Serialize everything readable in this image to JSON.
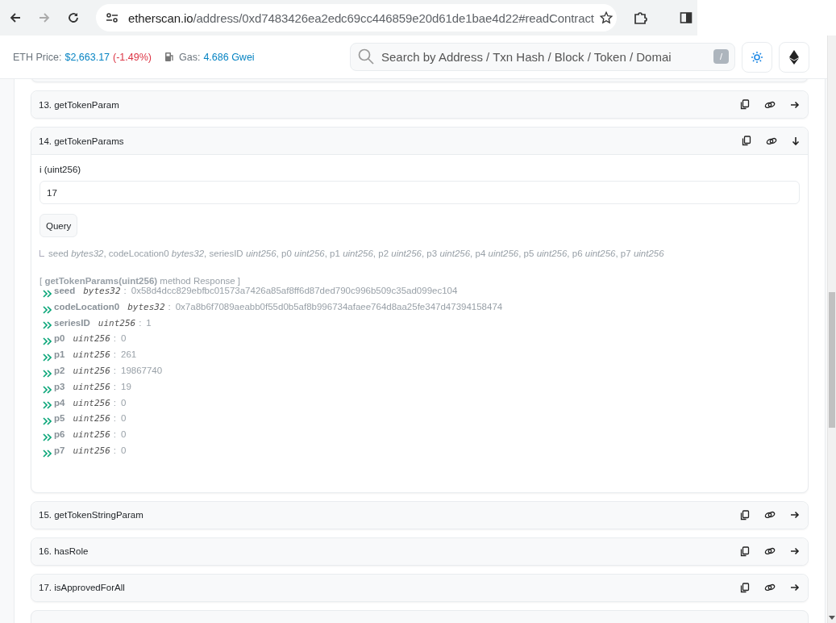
{
  "browser": {
    "url_host": "etherscan.io",
    "url_path": "/address/0xd7483426ea2edc69cc446859e20d61de1bae4d22#readContract",
    "forward_disabled": true
  },
  "header": {
    "price_label": "ETH Price:",
    "price": "$2,663.17",
    "price_change": "(-1.49%)",
    "gas_label": "Gas:",
    "gas": "4.686 Gwei",
    "search_placeholder": "Search by Address / Txn Hash / Block / Token / Domai",
    "search_key": "/"
  },
  "functions": [
    {
      "label": "13. getTokenParam",
      "expanded": false
    },
    {
      "label": "14. getTokenParams",
      "expanded": true,
      "input_label": "i (uint256)",
      "input_value": "17",
      "button": "Query",
      "signature": "seed *bytes32*, codeLocation0 *bytes32*, seriesID *uint256*, p0 *uint256*, p1 *uint256*, p2 *uint256*, p3 *uint256*, p4 *uint256*, p5 *uint256*, p6 *uint256*, p7 *uint256*",
      "response_title": "[ **getTokenParams(uint256)** method Response ]",
      "outputs": [
        {
          "name": "seed",
          "type": "bytes32",
          "separator": ":",
          "value": "0x58d4dcc829ebfbc01573a7426a85af8ff6d87ded790c996b509c35ad099ec104"
        },
        {
          "name": "codeLocation0",
          "type": "bytes32",
          "separator": ":",
          "value": "0x7a8b6f7089aeabb0f55d0b5af8b996734afaee764d8aa25fe347d47394158474"
        },
        {
          "name": "seriesID",
          "type": "uint256",
          "separator": ":",
          "value": "1"
        },
        {
          "name": "p0",
          "type": "uint256",
          "separator": ":",
          "value": "0"
        },
        {
          "name": "p1",
          "type": "uint256",
          "separator": ":",
          "value": "261"
        },
        {
          "name": "p2",
          "type": "uint256",
          "separator": ":",
          "value": "19867740"
        },
        {
          "name": "p3",
          "type": "uint256",
          "separator": ":",
          "value": "19"
        },
        {
          "name": "p4",
          "type": "uint256",
          "separator": ":",
          "value": "0"
        },
        {
          "name": "p5",
          "type": "uint256",
          "separator": ":",
          "value": "0"
        },
        {
          "name": "p6",
          "type": "uint256",
          "separator": ":",
          "value": "0"
        },
        {
          "name": "p7",
          "type": "uint256",
          "separator": ":",
          "value": "0"
        }
      ]
    },
    {
      "label": "15. getTokenStringParam",
      "expanded": false
    },
    {
      "label": "16. hasRole",
      "expanded": false
    },
    {
      "label": "17. isApprovedForAll",
      "expanded": false
    }
  ]
}
